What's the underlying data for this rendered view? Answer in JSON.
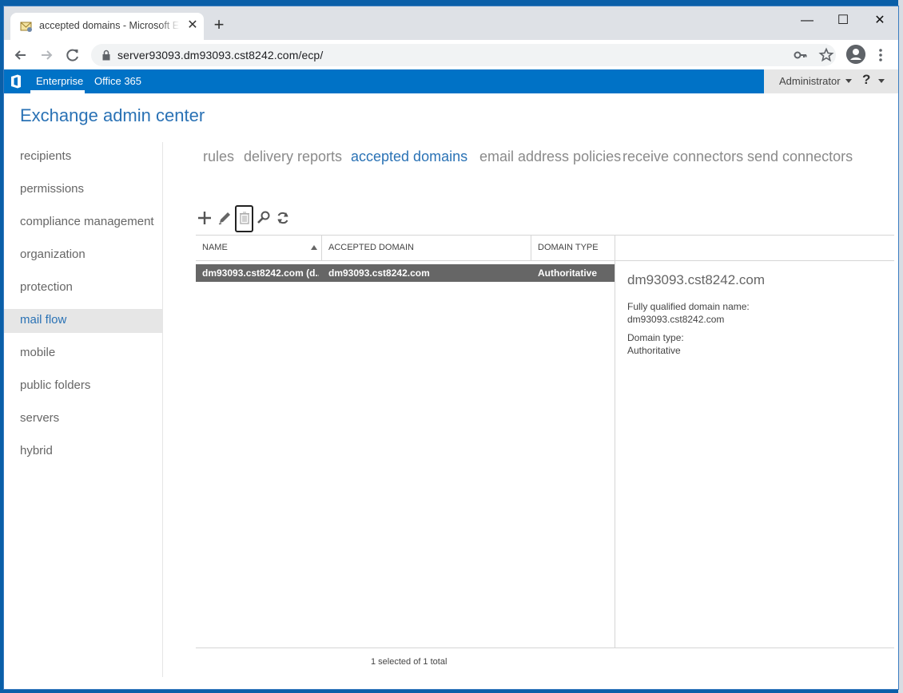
{
  "browser": {
    "tab_title": "accepted domains - Microsoft Exchange",
    "close_glyph": "✕",
    "new_tab_glyph": "+",
    "url": "server93093.dm93093.cst8242.com/ecp/",
    "window_controls": {
      "minimize": "—",
      "maximize": "☐",
      "close": "✕"
    },
    "icons": [
      "back-icon",
      "forward-icon",
      "reload-icon",
      "lock-icon",
      "key-icon",
      "star-icon",
      "profile-icon",
      "menu-icon"
    ]
  },
  "suite": {
    "enterprise": "Enterprise",
    "office365": "Office 365",
    "user": "Administrator",
    "help": "?",
    "brand_color": "#0072c6"
  },
  "app": {
    "title": "Exchange admin center"
  },
  "nav": {
    "items": [
      {
        "label": "recipients"
      },
      {
        "label": "permissions"
      },
      {
        "label": "compliance management"
      },
      {
        "label": "organization"
      },
      {
        "label": "protection"
      },
      {
        "label": "mail flow",
        "active": true
      },
      {
        "label": "mobile"
      },
      {
        "label": "public folders"
      },
      {
        "label": "servers"
      },
      {
        "label": "hybrid"
      }
    ]
  },
  "subtabs": [
    {
      "label": "rules"
    },
    {
      "label": "delivery reports"
    },
    {
      "label": "accepted domains",
      "active": true
    },
    {
      "label": "email address policies"
    },
    {
      "label": "receive connectors"
    },
    {
      "label": "send connectors"
    }
  ],
  "toolbar_icons": [
    "add-icon",
    "edit-icon",
    "delete-icon",
    "search-icon",
    "refresh-icon"
  ],
  "grid": {
    "columns": [
      "NAME",
      "ACCEPTED DOMAIN",
      "DOMAIN TYPE"
    ],
    "rows": [
      {
        "name": "dm93093.cst8242.com (d...",
        "accepted_domain": "dm93093.cst8242.com",
        "domain_type": "Authoritative",
        "selected": true
      }
    ]
  },
  "details": {
    "title": "dm93093.cst8242.com",
    "fqdn_label": "Fully qualified domain name:",
    "fqdn_value": "dm93093.cst8242.com",
    "type_label": "Domain type:",
    "type_value": "Authoritative"
  },
  "status": "1 selected of 1 total"
}
